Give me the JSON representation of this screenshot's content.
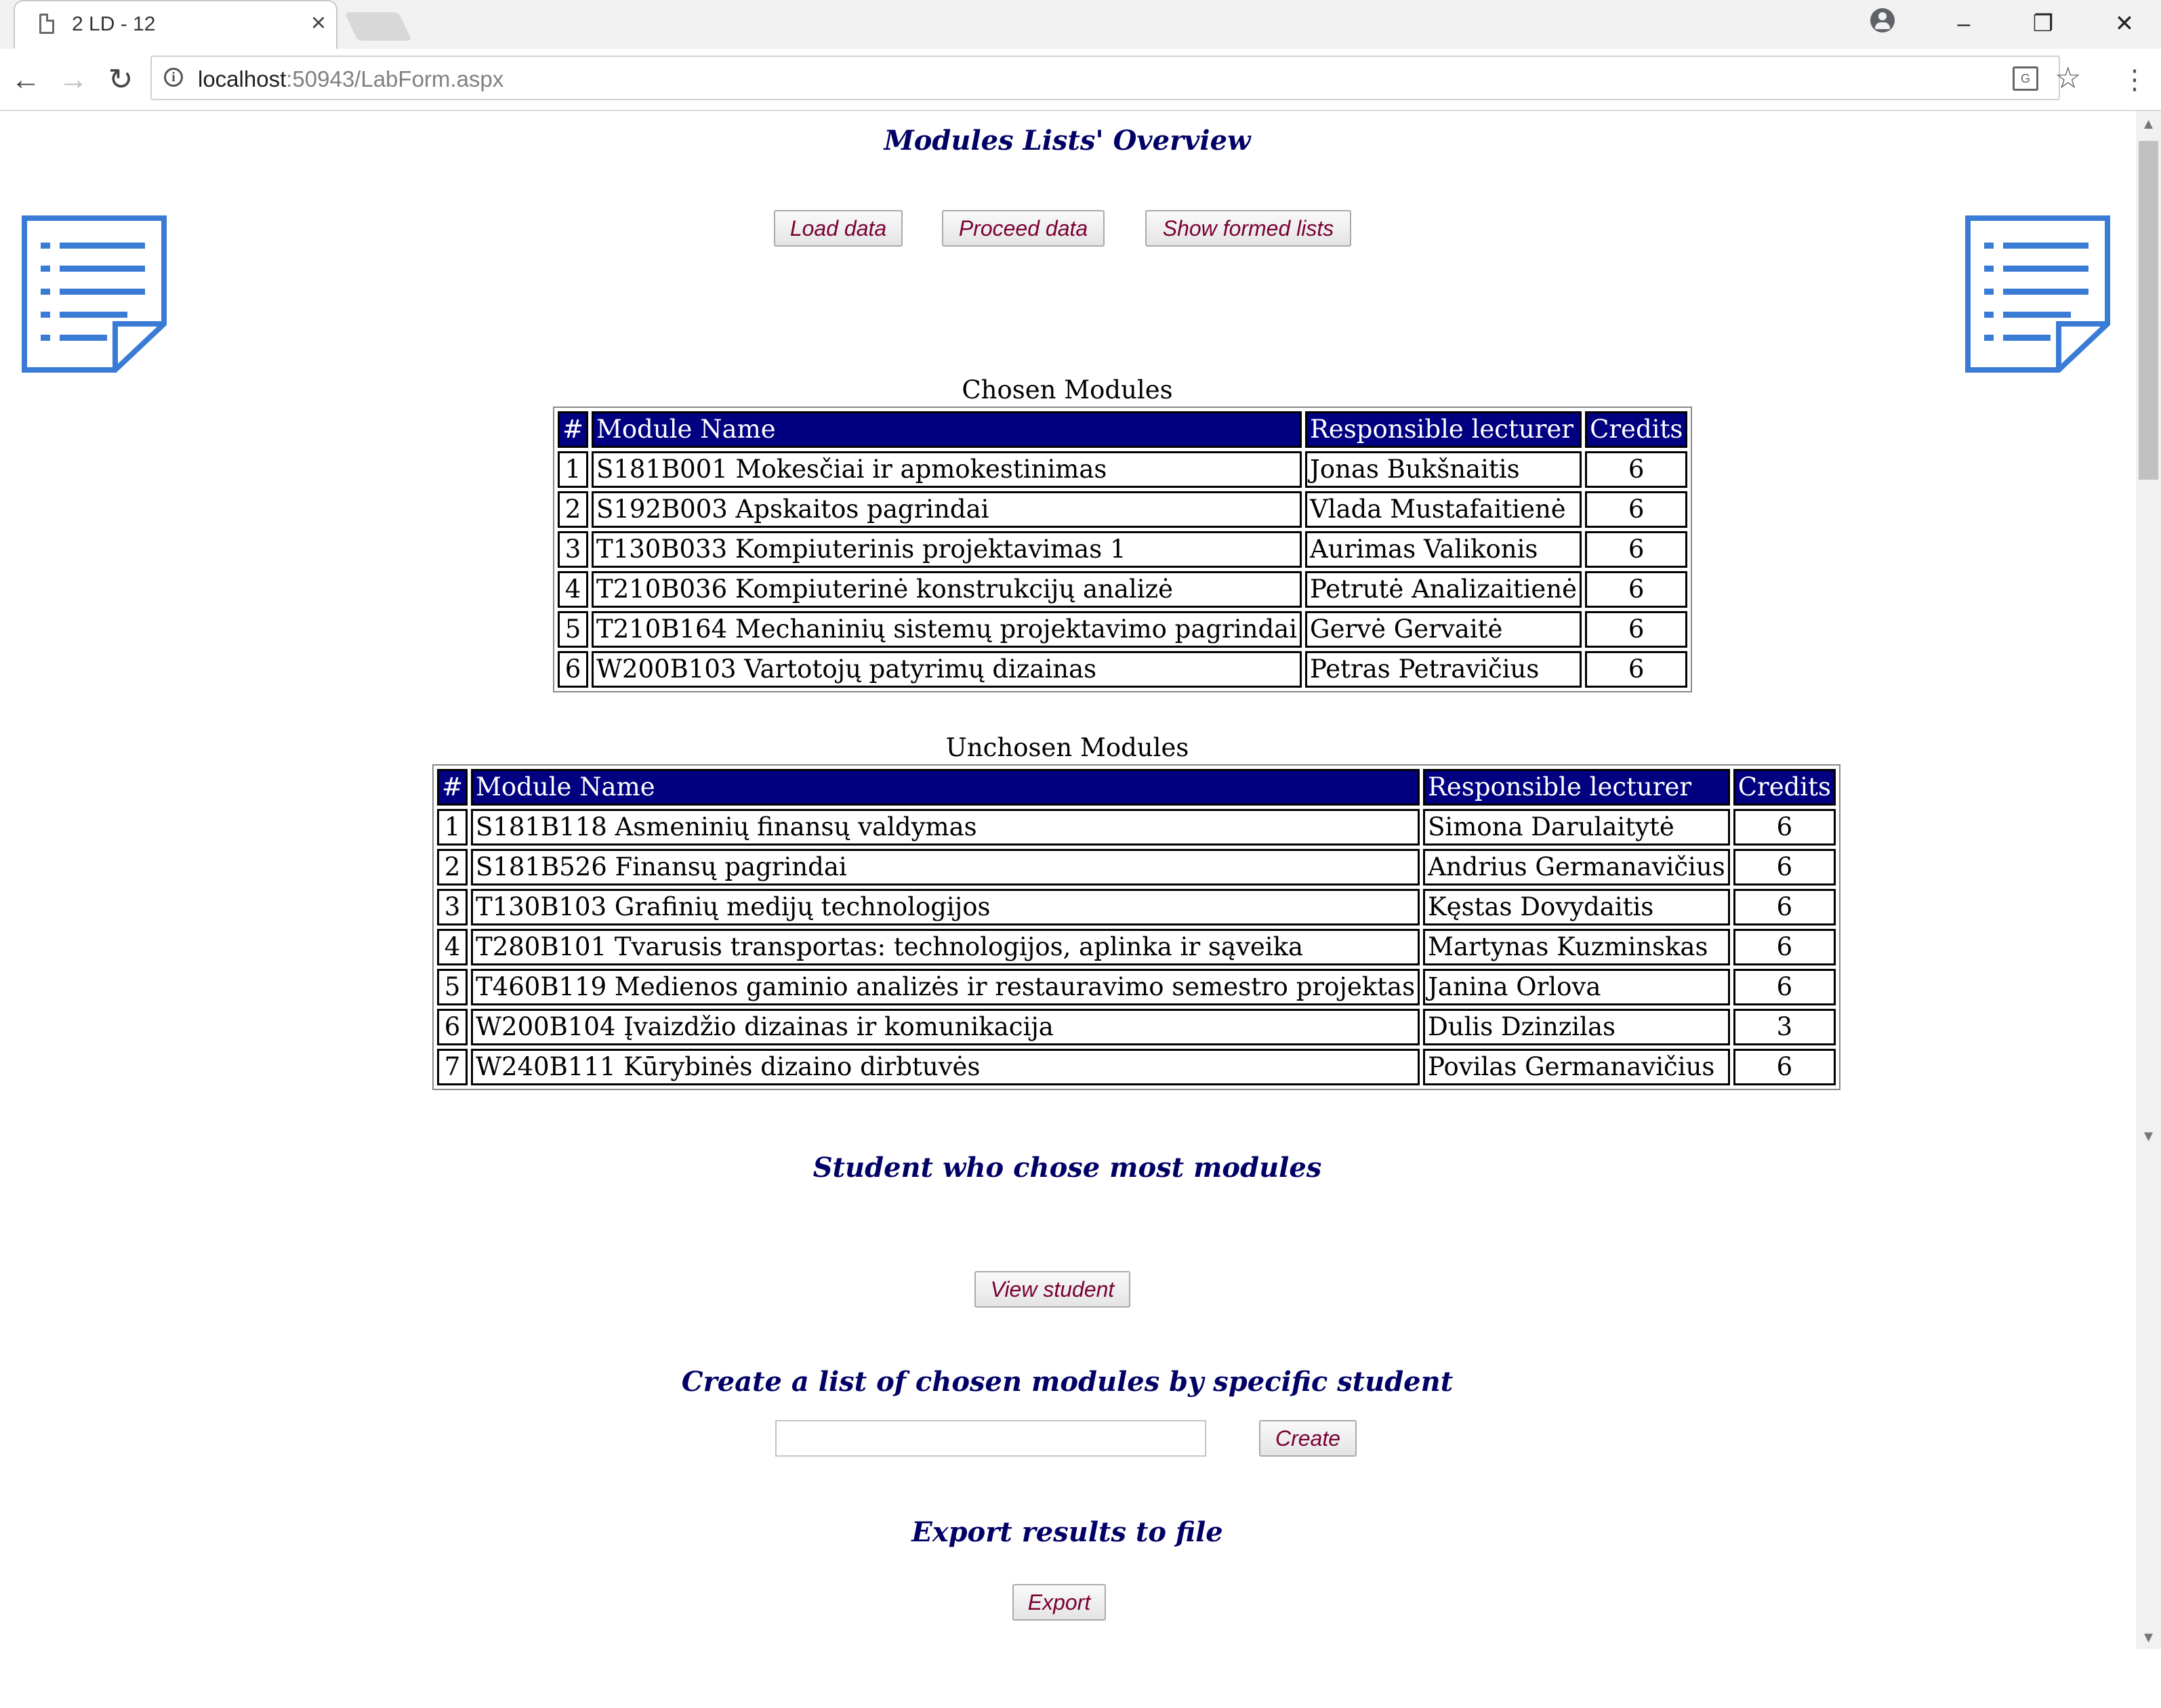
{
  "browser": {
    "tab_title": "2 LD - 12",
    "tab_close": "×",
    "url_host": "localhost",
    "url_rest": ":50943/LabForm.aspx",
    "info_glyph": "i",
    "star_glyph": "☆",
    "menu_glyph": "⋮",
    "back_glyph": "←",
    "forward_glyph": "→",
    "reload_glyph": "↻",
    "minimize_glyph": "–",
    "restore_glyph": "❐",
    "close_glyph": "✕",
    "translate_glyph": "G"
  },
  "page": {
    "title": "Modules Lists' Overview",
    "buttons": {
      "load": "Load data",
      "proceed": "Proceed data",
      "show": "Show formed lists",
      "view_student": "View student",
      "create": "Create",
      "export": "Export"
    },
    "student_title": "Student who chose most modules",
    "create_title": "Create a list of chosen modules by specific student",
    "create_input_value": "",
    "export_title": "Export results to file",
    "icons": {
      "left": "document-list-icon",
      "right": "document-list-icon",
      "color": "#3a7bd5"
    }
  },
  "colors": {
    "header_bg": "#000080",
    "title_text": "#000066",
    "button_text": "#7a0033"
  },
  "chosen": {
    "caption": "Chosen Modules",
    "headers": [
      "#",
      "Module Name",
      "Responsible lecturer",
      "Credits"
    ],
    "rows": [
      [
        "1",
        "S181B001 Mokesčiai ir apmokestinimas",
        "Jonas Bukšnaitis",
        "6"
      ],
      [
        "2",
        "S192B003 Apskaitos pagrindai",
        "Vlada Mustafaitienė",
        "6"
      ],
      [
        "3",
        "T130B033 Kompiuterinis projektavimas 1",
        "Aurimas Valikonis",
        "6"
      ],
      [
        "4",
        "T210B036 Kompiuterinė konstrukcijų analizė",
        "Petrutė Analizaitienė",
        "6"
      ],
      [
        "5",
        "T210B164 Mechaninių sistemų projektavimo pagrindai",
        "Gervė Gervaitė",
        "6"
      ],
      [
        "6",
        "W200B103 Vartotojų patyrimų dizainas",
        "Petras Petravičius",
        "6"
      ]
    ]
  },
  "unchosen": {
    "caption": "Unchosen Modules",
    "headers": [
      "#",
      "Module Name",
      "Responsible lecturer",
      "Credits"
    ],
    "rows": [
      [
        "1",
        "S181B118 Asmeninių finansų valdymas",
        "Simona Darulaitytė",
        "6"
      ],
      [
        "2",
        "S181B526 Finansų pagrindai",
        "Andrius Germanavičius",
        "6"
      ],
      [
        "3",
        "T130B103 Grafinių medijų technologijos",
        "Kęstas Dovydaitis",
        "6"
      ],
      [
        "4",
        "T280B101 Tvarusis transportas: technologijos, aplinka ir sąveika",
        "Martynas Kuzminskas",
        "6"
      ],
      [
        "5",
        "T460B119 Medienos gaminio analizės ir restauravimo semestro projektas",
        "Janina Orlova",
        "6"
      ],
      [
        "6",
        "W200B104 Įvaizdžio dizainas ir komunikacija",
        "Dulis Dzinzilas",
        "3"
      ],
      [
        "7",
        "W240B111 Kūrybinės dizaino dirbtuvės",
        "Povilas Germanavičius",
        "6"
      ]
    ]
  }
}
